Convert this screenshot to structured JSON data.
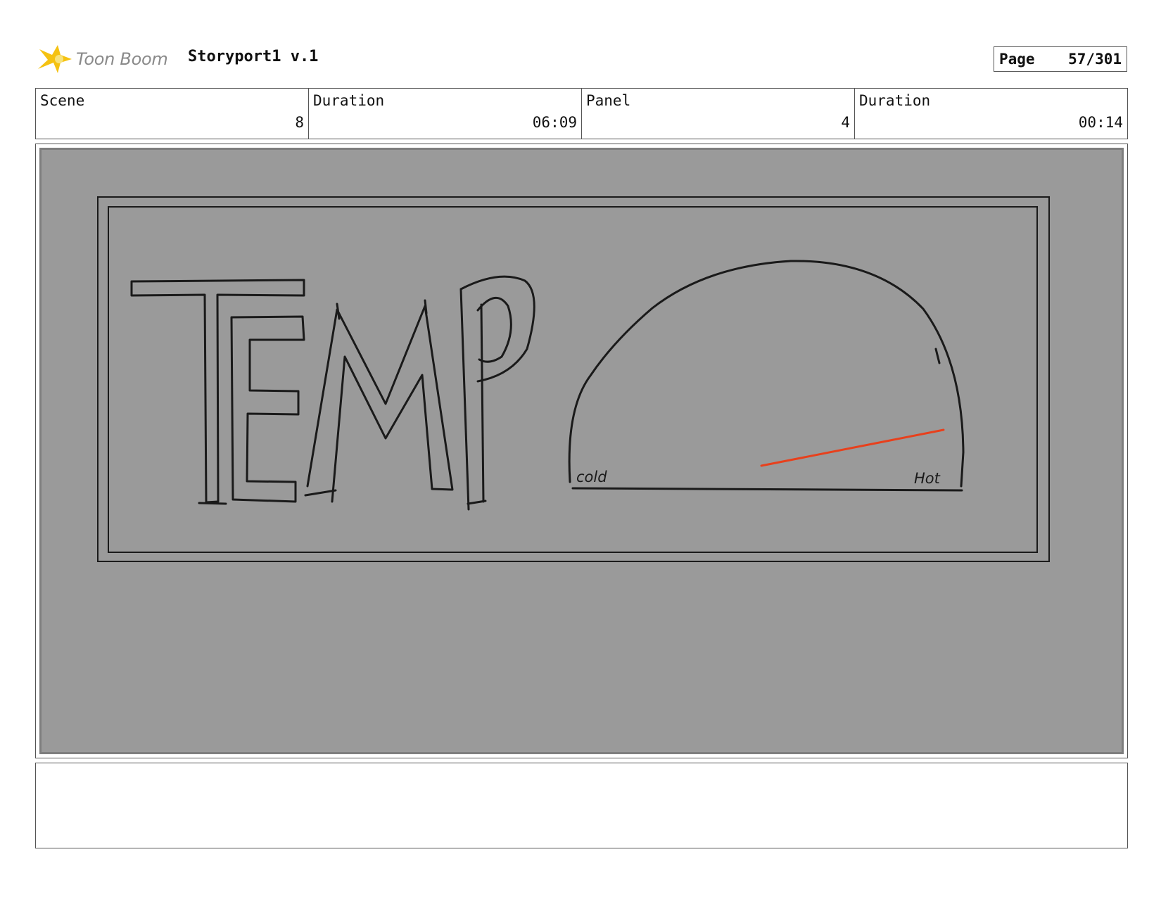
{
  "header": {
    "brand": "Toon Boom",
    "project_title": "Storyport1 v.1",
    "page_label": "Page",
    "page_value": "57/301"
  },
  "info": [
    {
      "label": "Scene",
      "value": "8"
    },
    {
      "label": "Duration",
      "value": "06:09"
    },
    {
      "label": "Panel",
      "value": "4"
    },
    {
      "label": "Duration",
      "value": "00:14"
    }
  ],
  "sketch": {
    "title": "TEMP",
    "gauge_low_label": "cold",
    "gauge_high_label": "Hot",
    "needle_color": "#e8401c"
  },
  "notes": ""
}
